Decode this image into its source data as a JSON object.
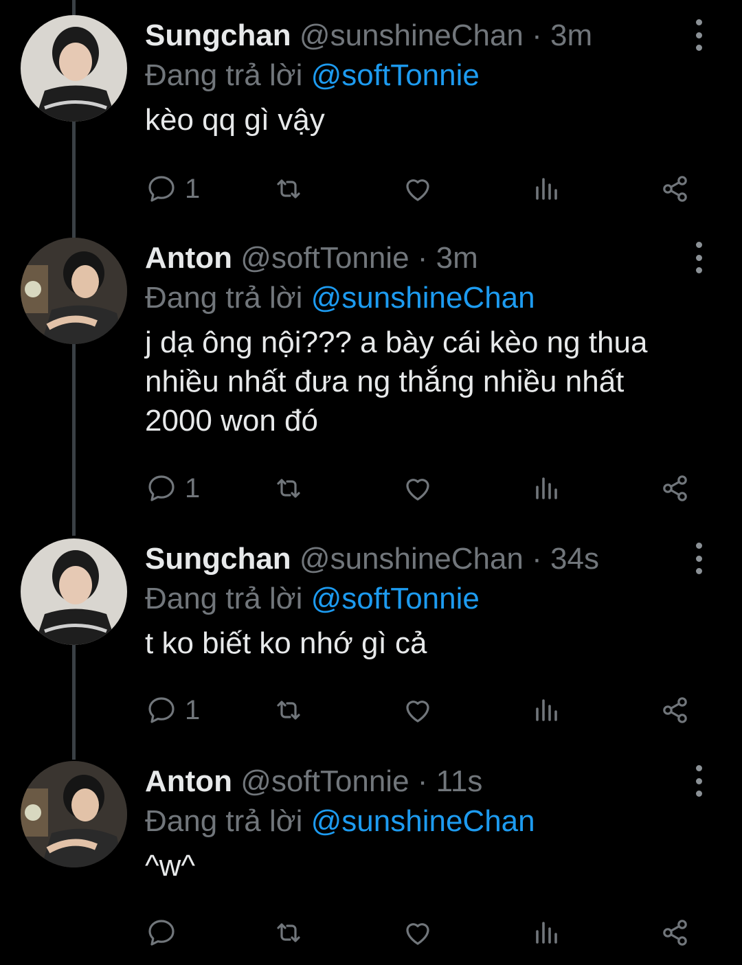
{
  "colors": {
    "background": "#000000",
    "text": "#e7e9ea",
    "muted": "#71767b",
    "link": "#1d9bf0"
  },
  "tweets": [
    {
      "name": "Sungchan",
      "handle": "@sunshineChan",
      "separator": "·",
      "time": "3m",
      "reply_prefix": "Đang trả lời",
      "reply_to": "@softTonnie",
      "text": "kèo qq gì vậy",
      "reply_count": "1",
      "icons": [
        "reply-icon",
        "retweet-icon",
        "like-icon",
        "views-icon",
        "share-icon"
      ]
    },
    {
      "name": "Anton",
      "handle": "@softTonnie",
      "separator": "·",
      "time": "3m",
      "reply_prefix": "Đang trả lời",
      "reply_to": "@sunshineChan",
      "text": "j dạ ông nội??? a bày cái kèo ng thua nhiều nhất đưa ng thắng nhiều nhất 2000 won đó",
      "reply_count": "1",
      "icons": [
        "reply-icon",
        "retweet-icon",
        "like-icon",
        "views-icon",
        "share-icon"
      ]
    },
    {
      "name": "Sungchan",
      "handle": "@sunshineChan",
      "separator": "·",
      "time": "34s",
      "reply_prefix": "Đang trả lời",
      "reply_to": "@softTonnie",
      "text": "t ko biết ko nhớ gì cả",
      "reply_count": "1",
      "icons": [
        "reply-icon",
        "retweet-icon",
        "like-icon",
        "views-icon",
        "share-icon"
      ]
    },
    {
      "name": "Anton",
      "handle": "@softTonnie",
      "separator": "·",
      "time": "11s",
      "reply_prefix": "Đang trả lời",
      "reply_to": "@sunshineChan",
      "text": "^w^",
      "reply_count": "",
      "icons": [
        "reply-icon",
        "retweet-icon",
        "like-icon",
        "views-icon",
        "share-icon"
      ]
    }
  ]
}
